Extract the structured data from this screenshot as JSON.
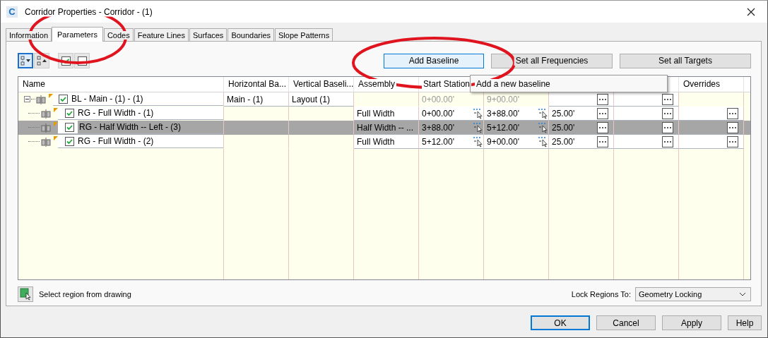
{
  "window": {
    "icon_letter": "C",
    "title": "Corridor Properties - Corridor - (1)"
  },
  "tabs": [
    {
      "label": "Information",
      "selected": false
    },
    {
      "label": "Parameters",
      "selected": true
    },
    {
      "label": "Codes",
      "selected": false
    },
    {
      "label": "Feature Lines",
      "selected": false
    },
    {
      "label": "Surfaces",
      "selected": false
    },
    {
      "label": "Boundaries",
      "selected": false
    },
    {
      "label": "Slope Patterns",
      "selected": false
    }
  ],
  "action_buttons": [
    {
      "label": "Add Baseline",
      "focused": true
    },
    {
      "label": "Set all Frequencies",
      "focused": false
    },
    {
      "label": "Set all Targets",
      "focused": false
    }
  ],
  "table": {
    "columns": [
      {
        "kind": "label",
        "label": "Name"
      },
      {
        "kind": "label",
        "label": "Horizontal Ba..."
      },
      {
        "kind": "label",
        "label": "Vertical Baseli..."
      },
      {
        "kind": "label",
        "label": "Assembly"
      },
      {
        "kind": "label",
        "label": "Start Station"
      },
      {
        "kind": "covered"
      },
      {
        "kind": "covered"
      },
      {
        "kind": "covered"
      },
      {
        "kind": "label",
        "label": "Overrides"
      }
    ],
    "rows": [
      {
        "kind": "baseline",
        "name": "BL - Main - (1) - (1)",
        "checked": true,
        "selected": false,
        "expanded": true,
        "horizontal_baseline": "Main - (1)",
        "vertical_baseline": "Layout (1)",
        "start_station": "0+00.00'",
        "end_station": "9+00.00'",
        "children": [
          {
            "kind": "region",
            "name": "RG - Full Width - (1)",
            "checked": true,
            "selected": false,
            "assembly": "Full Width",
            "start_station": "0+00.00'",
            "end_station": "3+88.00'",
            "column_7": "25.00'"
          },
          {
            "kind": "region",
            "name": "RG - Half Width -- Left - (3)",
            "checked": true,
            "selected": true,
            "assembly": "Half Width -- ...",
            "start_station": "3+88.00'",
            "end_station": "5+12.00'",
            "column_7": "25.00'"
          },
          {
            "kind": "region",
            "name": "RG - Full Width - (2)",
            "checked": true,
            "selected": false,
            "assembly": "Full Width",
            "start_station": "5+12.00'",
            "end_station": "9+00.00'",
            "column_7": "25.00'"
          }
        ]
      }
    ]
  },
  "tooltip": {
    "text": "Add a new baseline"
  },
  "select_region": {
    "label": "Select region from drawing"
  },
  "lock_regions": {
    "label": "Lock Regions To:",
    "value": "Geometry Locking"
  },
  "dialog_buttons": [
    {
      "label": "OK",
      "default": true
    },
    {
      "label": "Cancel",
      "default": false
    },
    {
      "label": "Apply",
      "default": false
    },
    {
      "label": "Help",
      "default": false
    }
  ]
}
